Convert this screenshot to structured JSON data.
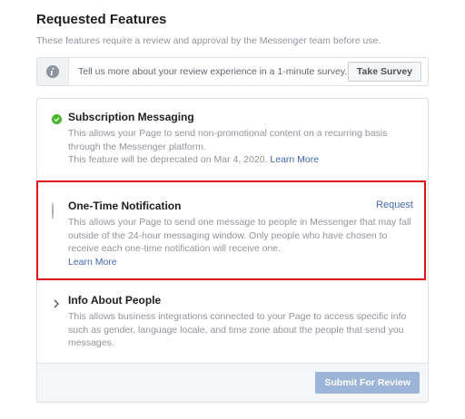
{
  "header": {
    "title": "Requested Features",
    "subtitle": "These features require a review and approval by the Messenger team before use."
  },
  "survey": {
    "icon": "info-icon",
    "text": "Tell us more about your review experience in a 1-minute survey.",
    "button_label": "Take Survey"
  },
  "features": [
    {
      "name": "Subscription Messaging",
      "status_icon": "check-icon",
      "description": "This allows your Page to send non-promotional content on a recurring basis through the Messenger platform.",
      "deprecation_note": "This feature will be deprecated on Mar 4, 2020.",
      "link_label": "Learn More"
    },
    {
      "name": "One-Time Notification",
      "status_icon": "radio-icon",
      "action_label": "Request",
      "description": "This allows your Page to send one message to people in Messenger that may fall outside of the 24-hour messaging window. Only people who have chosen to receive each one-time notification will receive one.",
      "link_label": "Learn More"
    },
    {
      "name": "Info About People",
      "status_icon": "chevron-right-icon",
      "description": "This allows business integrations connected to your Page to access specific info such as gender, language locale, and time zone about the people that send you messages."
    }
  ],
  "footer": {
    "submit_label": "Submit For Review",
    "submit_enabled": false
  },
  "colors": {
    "link": "#4267b2",
    "success": "#42b72a",
    "highlight": "#e0101a",
    "submit_disabled": "#9cb4d8"
  }
}
